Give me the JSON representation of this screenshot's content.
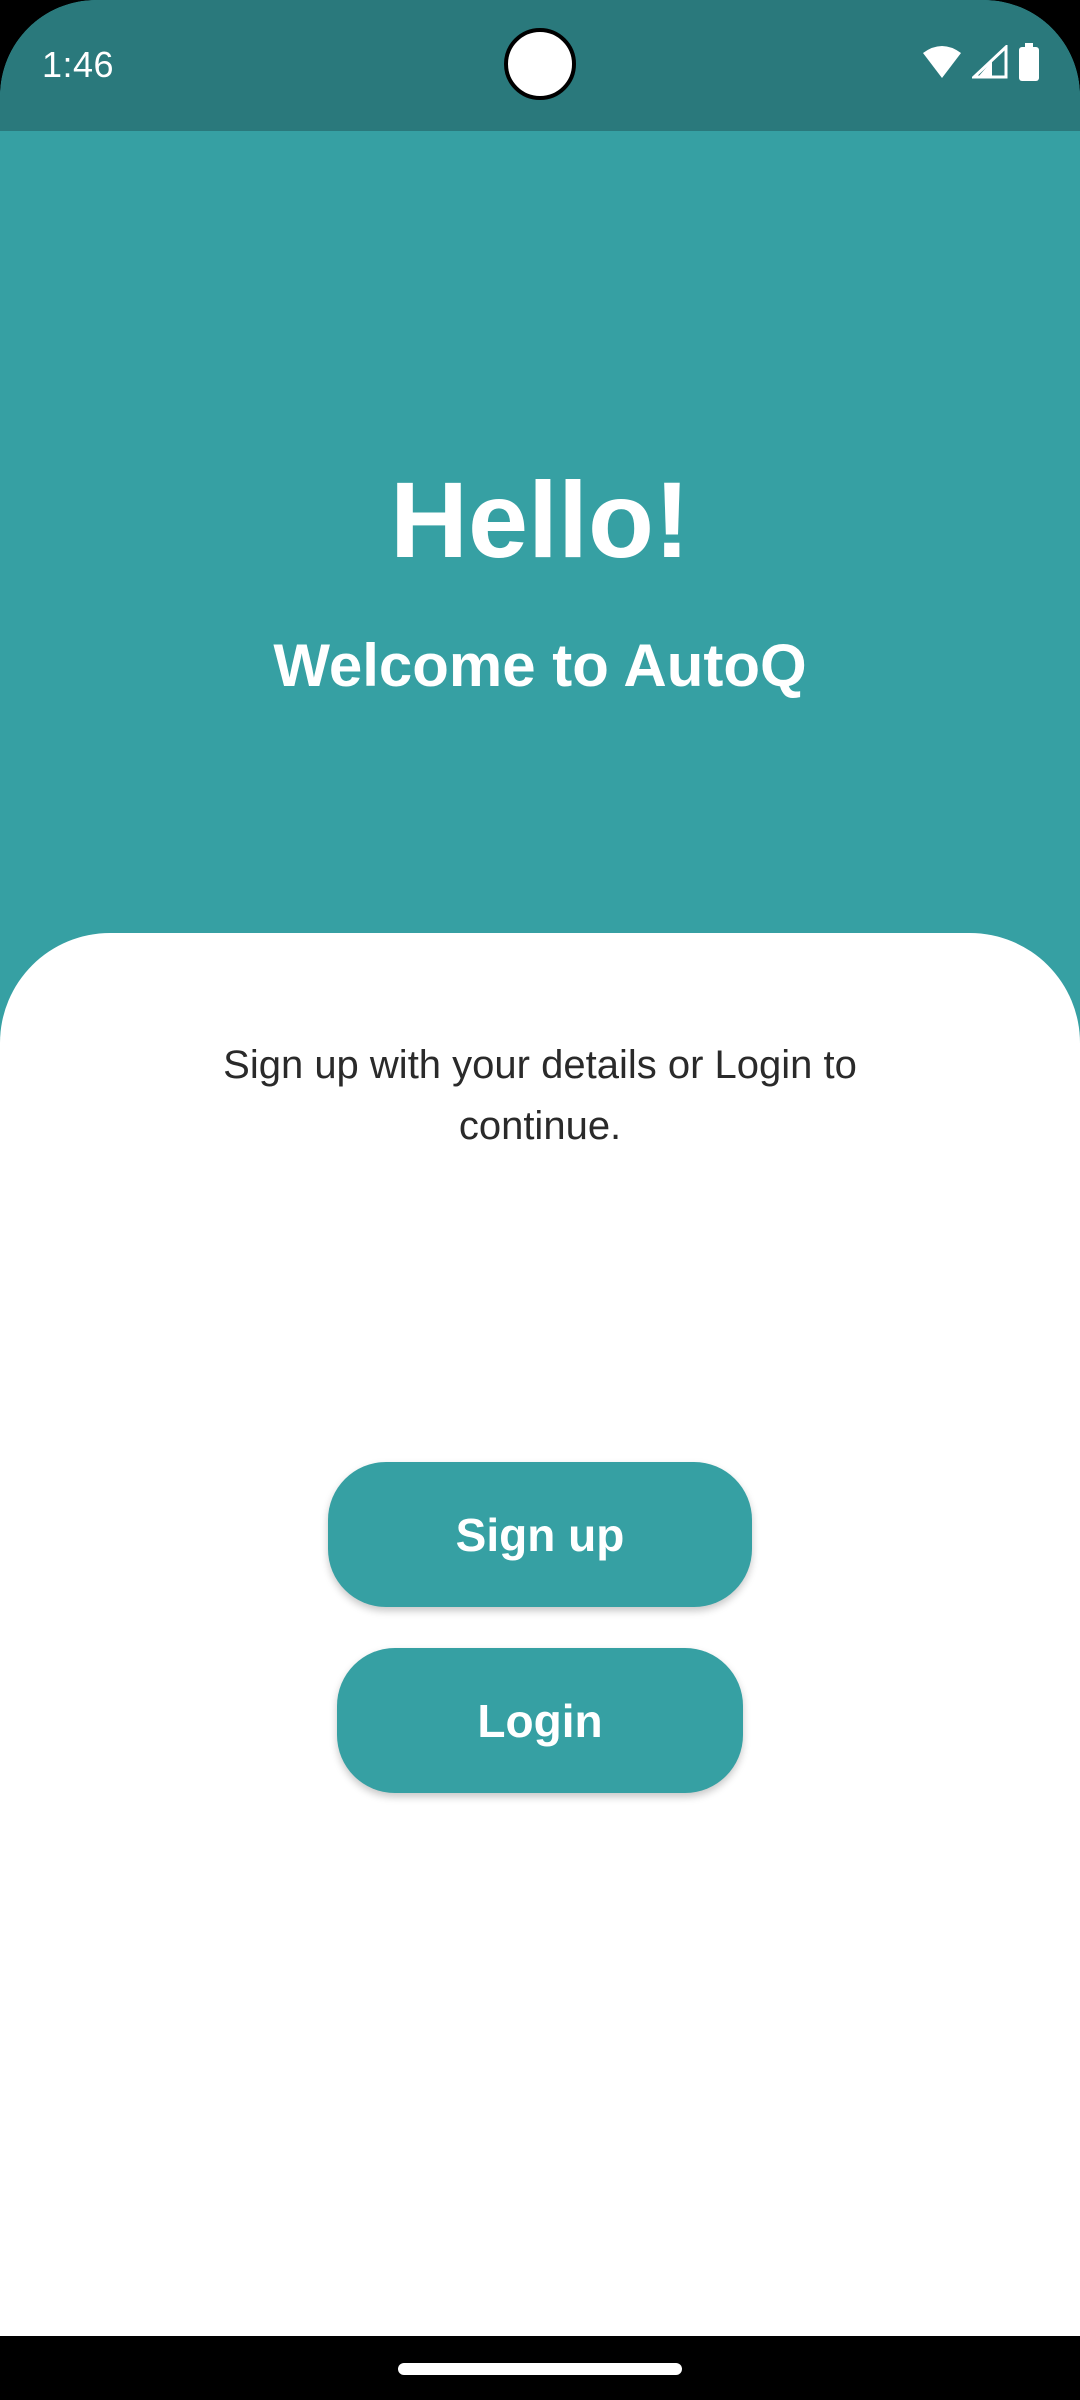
{
  "status_bar": {
    "time": "1:46",
    "icons": [
      "wifi-icon",
      "cell-signal-icon",
      "battery-icon"
    ],
    "background": "#2a797c"
  },
  "hero": {
    "title": "Hello!",
    "subtitle": "Welcome to AutoQ",
    "background": "#36a0a3"
  },
  "sheet": {
    "message": "Sign up with your details or Login to continue."
  },
  "buttons": {
    "signup_label": "Sign up",
    "login_label": "Login",
    "color": "#36a0a3"
  }
}
